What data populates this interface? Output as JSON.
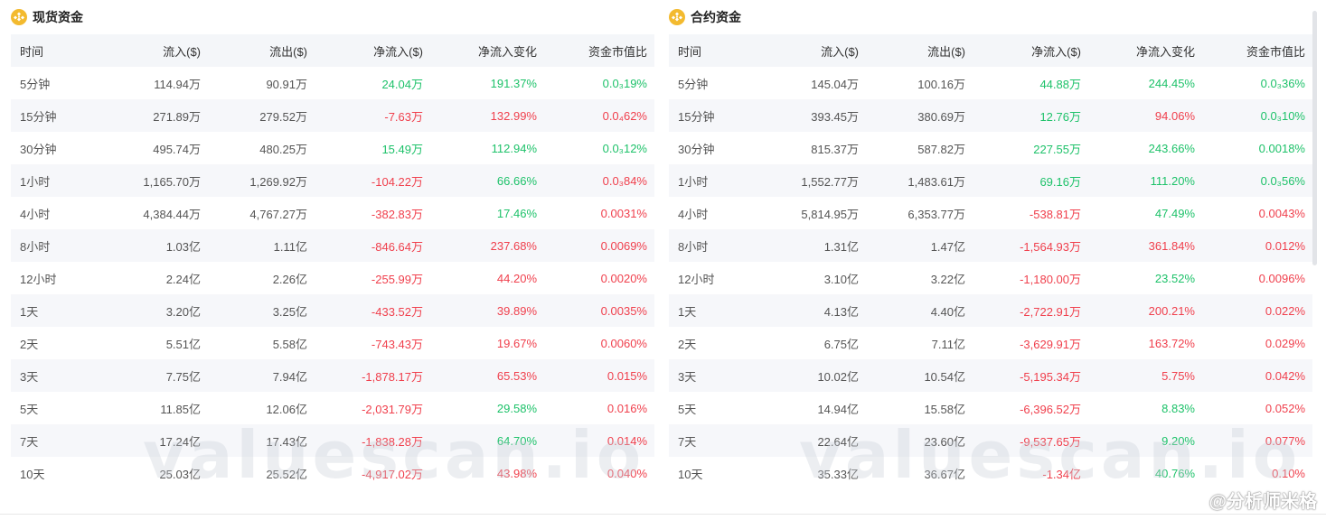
{
  "headers": [
    "时间",
    "流入($)",
    "流出($)",
    "净流入($)",
    "净流入变化",
    "资金市值比"
  ],
  "spot": {
    "title": "现货资金",
    "rows": [
      {
        "time": "5分钟",
        "in": "114.94万",
        "out": "90.91万",
        "net": "24.04万",
        "chg": "191.37%",
        "ratio": "0.0₃19%",
        "net_sign": "pos",
        "chg_sign": "pos",
        "ratio_sign": "pos"
      },
      {
        "time": "15分钟",
        "in": "271.89万",
        "out": "279.52万",
        "net": "-7.63万",
        "chg": "132.99%",
        "ratio": "0.0₄62%",
        "net_sign": "neg",
        "chg_sign": "neg",
        "ratio_sign": "neg"
      },
      {
        "time": "30分钟",
        "in": "495.74万",
        "out": "480.25万",
        "net": "15.49万",
        "chg": "112.94%",
        "ratio": "0.0₃12%",
        "net_sign": "pos",
        "chg_sign": "pos",
        "ratio_sign": "pos"
      },
      {
        "time": "1小时",
        "in": "1,165.70万",
        "out": "1,269.92万",
        "net": "-104.22万",
        "chg": "66.66%",
        "ratio": "0.0₃84%",
        "net_sign": "neg",
        "chg_sign": "pos",
        "ratio_sign": "neg"
      },
      {
        "time": "4小时",
        "in": "4,384.44万",
        "out": "4,767.27万",
        "net": "-382.83万",
        "chg": "17.46%",
        "ratio": "0.0031%",
        "net_sign": "neg",
        "chg_sign": "pos",
        "ratio_sign": "neg"
      },
      {
        "time": "8小时",
        "in": "1.03亿",
        "out": "1.11亿",
        "net": "-846.64万",
        "chg": "237.68%",
        "ratio": "0.0069%",
        "net_sign": "neg",
        "chg_sign": "neg",
        "ratio_sign": "neg"
      },
      {
        "time": "12小时",
        "in": "2.24亿",
        "out": "2.26亿",
        "net": "-255.99万",
        "chg": "44.20%",
        "ratio": "0.0020%",
        "net_sign": "neg",
        "chg_sign": "neg",
        "ratio_sign": "neg"
      },
      {
        "time": "1天",
        "in": "3.20亿",
        "out": "3.25亿",
        "net": "-433.52万",
        "chg": "39.89%",
        "ratio": "0.0035%",
        "net_sign": "neg",
        "chg_sign": "neg",
        "ratio_sign": "neg"
      },
      {
        "time": "2天",
        "in": "5.51亿",
        "out": "5.58亿",
        "net": "-743.43万",
        "chg": "19.67%",
        "ratio": "0.0060%",
        "net_sign": "neg",
        "chg_sign": "neg",
        "ratio_sign": "neg"
      },
      {
        "time": "3天",
        "in": "7.75亿",
        "out": "7.94亿",
        "net": "-1,878.17万",
        "chg": "65.53%",
        "ratio": "0.015%",
        "net_sign": "neg",
        "chg_sign": "neg",
        "ratio_sign": "neg"
      },
      {
        "time": "5天",
        "in": "11.85亿",
        "out": "12.06亿",
        "net": "-2,031.79万",
        "chg": "29.58%",
        "ratio": "0.016%",
        "net_sign": "neg",
        "chg_sign": "pos",
        "ratio_sign": "neg"
      },
      {
        "time": "7天",
        "in": "17.24亿",
        "out": "17.43亿",
        "net": "-1,838.28万",
        "chg": "64.70%",
        "ratio": "0.014%",
        "net_sign": "neg",
        "chg_sign": "pos",
        "ratio_sign": "neg"
      },
      {
        "time": "10天",
        "in": "25.03亿",
        "out": "25.52亿",
        "net": "-4,917.02万",
        "chg": "43.98%",
        "ratio": "0.040%",
        "net_sign": "neg",
        "chg_sign": "neg",
        "ratio_sign": "neg"
      }
    ]
  },
  "futures": {
    "title": "合约资金",
    "rows": [
      {
        "time": "5分钟",
        "in": "145.04万",
        "out": "100.16万",
        "net": "44.88万",
        "chg": "244.45%",
        "ratio": "0.0₃36%",
        "net_sign": "pos",
        "chg_sign": "pos",
        "ratio_sign": "pos"
      },
      {
        "time": "15分钟",
        "in": "393.45万",
        "out": "380.69万",
        "net": "12.76万",
        "chg": "94.06%",
        "ratio": "0.0₃10%",
        "net_sign": "pos",
        "chg_sign": "neg",
        "ratio_sign": "pos"
      },
      {
        "time": "30分钟",
        "in": "815.37万",
        "out": "587.82万",
        "net": "227.55万",
        "chg": "243.66%",
        "ratio": "0.0018%",
        "net_sign": "pos",
        "chg_sign": "pos",
        "ratio_sign": "pos"
      },
      {
        "time": "1小时",
        "in": "1,552.77万",
        "out": "1,483.61万",
        "net": "69.16万",
        "chg": "111.20%",
        "ratio": "0.0₃56%",
        "net_sign": "pos",
        "chg_sign": "pos",
        "ratio_sign": "pos"
      },
      {
        "time": "4小时",
        "in": "5,814.95万",
        "out": "6,353.77万",
        "net": "-538.81万",
        "chg": "47.49%",
        "ratio": "0.0043%",
        "net_sign": "neg",
        "chg_sign": "pos",
        "ratio_sign": "neg"
      },
      {
        "time": "8小时",
        "in": "1.31亿",
        "out": "1.47亿",
        "net": "-1,564.93万",
        "chg": "361.84%",
        "ratio": "0.012%",
        "net_sign": "neg",
        "chg_sign": "neg",
        "ratio_sign": "neg"
      },
      {
        "time": "12小时",
        "in": "3.10亿",
        "out": "3.22亿",
        "net": "-1,180.00万",
        "chg": "23.52%",
        "ratio": "0.0096%",
        "net_sign": "neg",
        "chg_sign": "pos",
        "ratio_sign": "neg"
      },
      {
        "time": "1天",
        "in": "4.13亿",
        "out": "4.40亿",
        "net": "-2,722.91万",
        "chg": "200.21%",
        "ratio": "0.022%",
        "net_sign": "neg",
        "chg_sign": "neg",
        "ratio_sign": "neg"
      },
      {
        "time": "2天",
        "in": "6.75亿",
        "out": "7.11亿",
        "net": "-3,629.91万",
        "chg": "163.72%",
        "ratio": "0.029%",
        "net_sign": "neg",
        "chg_sign": "neg",
        "ratio_sign": "neg"
      },
      {
        "time": "3天",
        "in": "10.02亿",
        "out": "10.54亿",
        "net": "-5,195.34万",
        "chg": "5.75%",
        "ratio": "0.042%",
        "net_sign": "neg",
        "chg_sign": "neg",
        "ratio_sign": "neg"
      },
      {
        "time": "5天",
        "in": "14.94亿",
        "out": "15.58亿",
        "net": "-6,396.52万",
        "chg": "8.83%",
        "ratio": "0.052%",
        "net_sign": "neg",
        "chg_sign": "pos",
        "ratio_sign": "neg"
      },
      {
        "time": "7天",
        "in": "22.64亿",
        "out": "23.60亿",
        "net": "-9,537.65万",
        "chg": "9.20%",
        "ratio": "0.077%",
        "net_sign": "neg",
        "chg_sign": "pos",
        "ratio_sign": "neg"
      },
      {
        "time": "10天",
        "in": "35.33亿",
        "out": "36.67亿",
        "net": "-1.34亿",
        "chg": "40.76%",
        "ratio": "0.10%",
        "net_sign": "neg",
        "chg_sign": "pos",
        "ratio_sign": "neg"
      }
    ]
  },
  "watermark_text": "valuescan.io",
  "credit_text": "@分析师米格",
  "icons": {
    "panel": "bnb-coin-icon",
    "credit": "weibo-logo-icon"
  },
  "colors": {
    "positive": "#1ec26a",
    "negative": "#f0404d",
    "coin": "#f3ba2f"
  }
}
